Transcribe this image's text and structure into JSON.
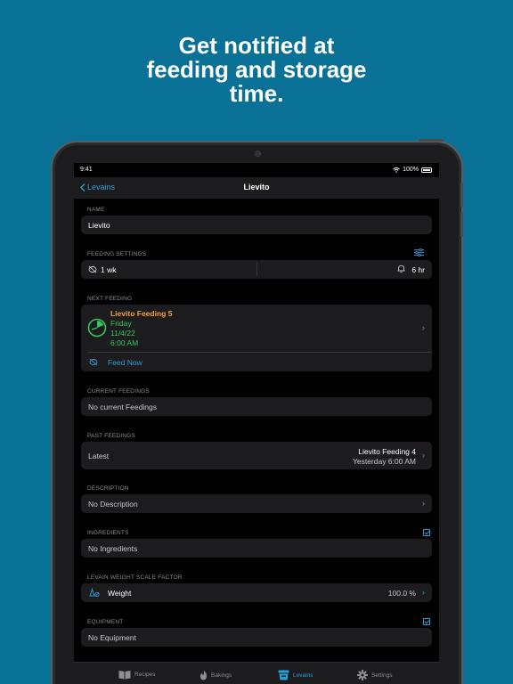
{
  "headline": {
    "line1": "Get notified at",
    "line2": "feeding and storage",
    "line3": "time."
  },
  "status": {
    "time": "9:41",
    "battery": "100%"
  },
  "nav": {
    "back_label": "Levains",
    "title": "Lievito"
  },
  "name": {
    "label": "NAME",
    "value": "Lievito"
  },
  "feeding_settings": {
    "label": "FEEDING SETTINGS",
    "interval": "1 wk",
    "reminder": "6 hr"
  },
  "next_feeding": {
    "label": "NEXT FEEDING",
    "title": "Lievito Feeding 5",
    "day": "Friday",
    "date": "11/4/22",
    "time": "6:00 AM",
    "feed_now": "Feed Now"
  },
  "current_feedings": {
    "label": "CURRENT FEEDINGS",
    "value": "No current Feedings"
  },
  "past_feedings": {
    "label": "PAST FEEDINGS",
    "row_label": "Latest",
    "latest_title": "Lievito Feeding 4",
    "latest_time": "Yesterday 6:00 AM"
  },
  "description": {
    "label": "DESCRIPTION",
    "value": "No Description"
  },
  "ingredients": {
    "label": "INGREDIENTS",
    "value": "No Ingredients"
  },
  "scale": {
    "label": "LEVAIN WEIGHT SCALE FACTOR",
    "row_label": "Weight",
    "value": "100.0 %"
  },
  "equipment": {
    "label": "EQUIPMENT",
    "value": "No Equipment"
  },
  "tabs": [
    {
      "label": "Recipes",
      "icon": "book-icon"
    },
    {
      "label": "Bakings",
      "icon": "flame-icon"
    },
    {
      "label": "Levains",
      "icon": "jar-icon"
    },
    {
      "label": "Settings",
      "icon": "gear-icon"
    }
  ],
  "colors": {
    "background": "#0a7196",
    "accent": "#2a9fd6",
    "highlight": "#f2a03a",
    "success": "#34c759"
  }
}
